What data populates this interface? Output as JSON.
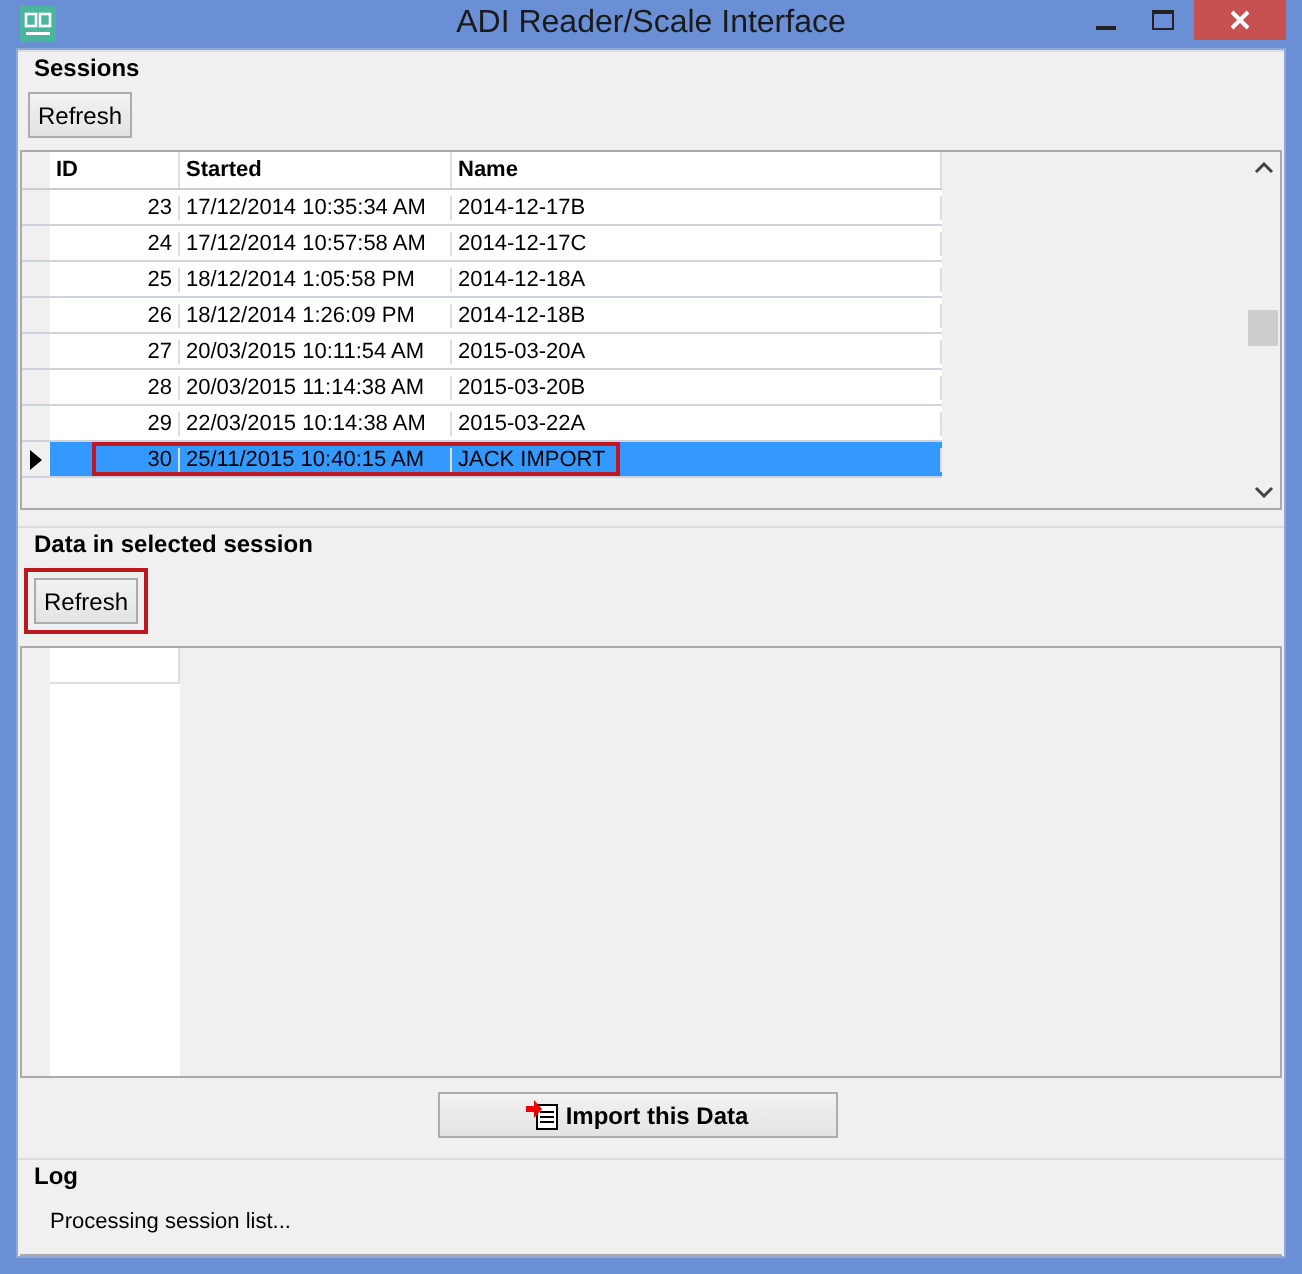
{
  "window": {
    "title": "ADI Reader/Scale Interface"
  },
  "sessions": {
    "label": "Sessions",
    "refresh_button": {
      "label": "Refresh",
      "highlighted": false
    },
    "columns": [
      "ID",
      "Started",
      "Name"
    ],
    "rows": [
      {
        "id": "23",
        "started": "17/12/2014 10:35:34 AM",
        "name": "2014-12-17B",
        "selected": false,
        "highlighted": false
      },
      {
        "id": "24",
        "started": "17/12/2014 10:57:58 AM",
        "name": "2014-12-17C",
        "selected": false,
        "highlighted": false
      },
      {
        "id": "25",
        "started": "18/12/2014 1:05:58 PM",
        "name": "2014-12-18A",
        "selected": false,
        "highlighted": false
      },
      {
        "id": "26",
        "started": "18/12/2014 1:26:09 PM",
        "name": "2014-12-18B",
        "selected": false,
        "highlighted": false
      },
      {
        "id": "27",
        "started": "20/03/2015 10:11:54 AM",
        "name": "2015-03-20A",
        "selected": false,
        "highlighted": false
      },
      {
        "id": "28",
        "started": "20/03/2015 11:14:38 AM",
        "name": "2015-03-20B",
        "selected": false,
        "highlighted": false
      },
      {
        "id": "29",
        "started": "22/03/2015 10:14:38 AM",
        "name": "2015-03-22A",
        "selected": false,
        "highlighted": false
      },
      {
        "id": "30",
        "started": "25/11/2015 10:40:15 AM",
        "name": "JACK IMPORT",
        "selected": true,
        "highlighted": true
      }
    ]
  },
  "data": {
    "label": "Data in selected session",
    "refresh_button": {
      "label": "Refresh",
      "highlighted": true
    }
  },
  "import_button": {
    "label": "Import this Data"
  },
  "log": {
    "label": "Log",
    "text": "Processing session list..."
  }
}
